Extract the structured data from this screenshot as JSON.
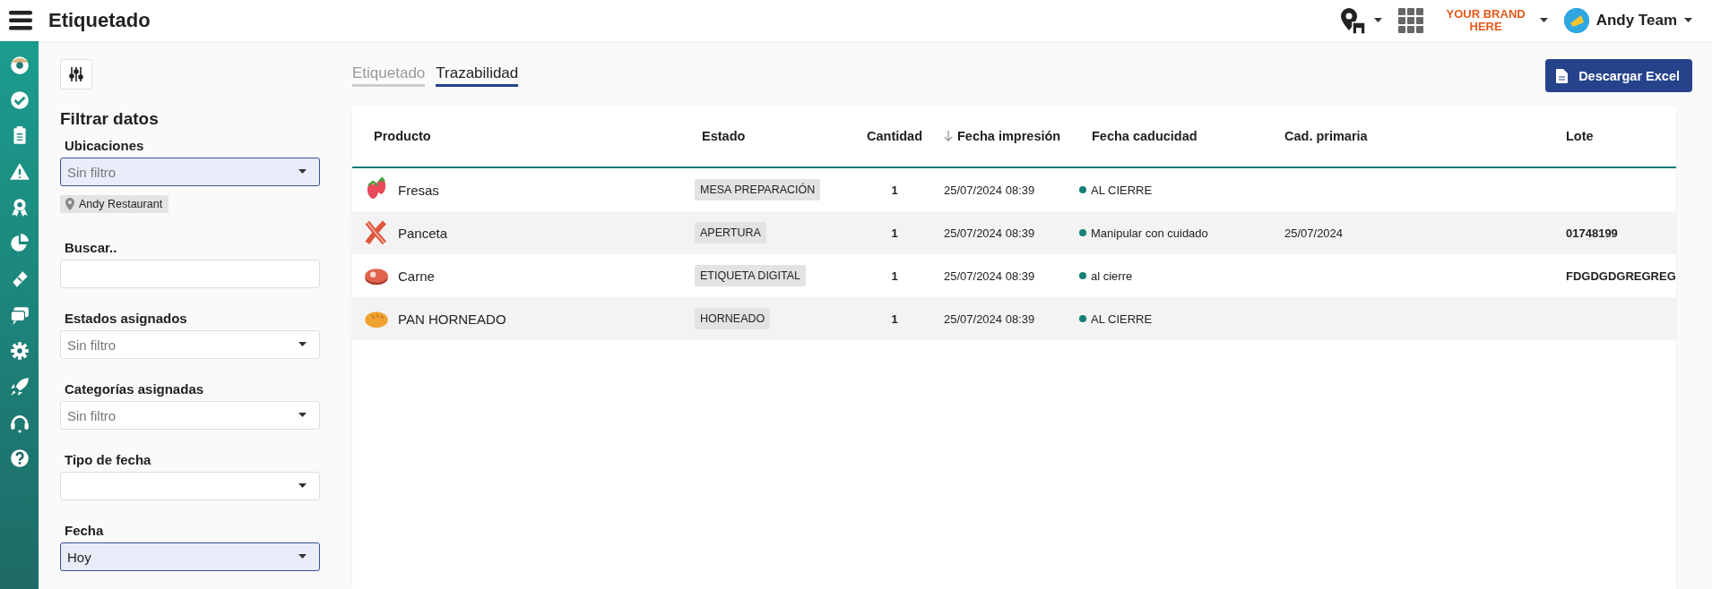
{
  "header": {
    "title": "Etiquetado",
    "brand": "YOUR BRAND HERE",
    "user": "Andy Team"
  },
  "filters": {
    "title": "Filtrar datos",
    "fields": [
      {
        "kind": "select",
        "label": "Ubicaciones",
        "placeholder": "Sin filtro",
        "active": true,
        "chips": [
          "Andy Restaurant"
        ]
      },
      {
        "kind": "text",
        "label": "Buscar.."
      },
      {
        "kind": "select",
        "label": "Estados asignados",
        "placeholder": "Sin filtro",
        "active": false
      },
      {
        "kind": "select",
        "label": "Categorías asignadas",
        "placeholder": "Sin filtro",
        "active": false
      },
      {
        "kind": "select",
        "label": "Tipo de fecha",
        "active": false
      },
      {
        "kind": "select",
        "label": "Fecha",
        "value": "Hoy",
        "active": true
      }
    ]
  },
  "tabs": [
    {
      "label": "Etiquetado",
      "selected": false
    },
    {
      "label": "Trazabilidad",
      "selected": true
    }
  ],
  "download_button": "Descargar Excel",
  "table": {
    "columns": [
      {
        "label": "Producto",
        "sorted": false
      },
      {
        "label": "Estado",
        "sorted": false
      },
      {
        "label": "Cantidad",
        "sorted": false
      },
      {
        "label": "Fecha impresión",
        "sorted": true
      },
      {
        "label": "Fecha caducidad",
        "sorted": false
      },
      {
        "label": "Cad. primaria",
        "sorted": false
      },
      {
        "label": "Lote",
        "sorted": false
      }
    ],
    "rows": [
      {
        "kind": "strawberry",
        "product": "Fresas",
        "status": "MESA PREPARACIÓN",
        "quantity": "1",
        "printed": "25/07/2024 08:39",
        "expiry": "AL CIERRE"
      },
      {
        "kind": "bacon",
        "product": "Panceta",
        "status": "APERTURA",
        "quantity": "1",
        "printed": "25/07/2024 08:39",
        "expiry": "Manipular con cuidado",
        "primary": "25/07/2024",
        "lot": "01748199"
      },
      {
        "kind": "steak",
        "product": "Carne",
        "status": "ETIQUETA DIGITAL",
        "quantity": "1",
        "printed": "25/07/2024 08:39",
        "expiry": "al cierre",
        "lot": "FDGDGDGREGREG"
      },
      {
        "kind": "bread",
        "product": "PAN HORNEADO",
        "status": "HORNEADO",
        "quantity": "1",
        "printed": "25/07/2024 08:39",
        "expiry": "AL CIERRE"
      }
    ]
  }
}
